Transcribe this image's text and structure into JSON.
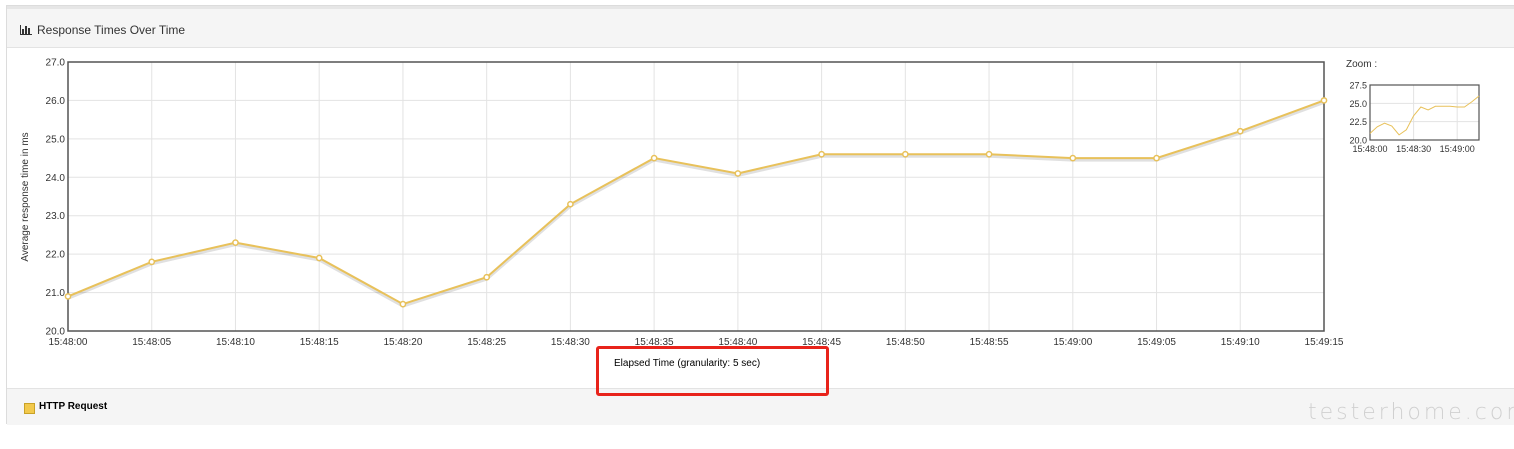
{
  "panel": {
    "title": "Response Times Over Time"
  },
  "legend": {
    "items": [
      {
        "label": "HTTP Request",
        "color": "#f2c94c"
      }
    ]
  },
  "zoom": {
    "label": "Zoom :",
    "y_ticks": [
      "27.5",
      "25.0",
      "22.5",
      "20.0"
    ],
    "x_ticks": [
      "15:48:00",
      "15:48:30",
      "15:49:00"
    ]
  },
  "watermark": "testerhome.com",
  "colors": {
    "series": "#e8c15a",
    "annotation": "#e8231b",
    "grid": "#e3e3e3"
  },
  "chart_data": {
    "type": "line",
    "title": "",
    "xlabel": "Elapsed Time (granularity: 5 sec)",
    "ylabel": "Average response time in ms",
    "categories": [
      "15:48:00",
      "15:48:05",
      "15:48:10",
      "15:48:15",
      "15:48:20",
      "15:48:25",
      "15:48:30",
      "15:48:35",
      "15:48:40",
      "15:48:45",
      "15:48:50",
      "15:48:55",
      "15:49:00",
      "15:49:05",
      "15:49:10",
      "15:49:15"
    ],
    "series": [
      {
        "name": "HTTP Request",
        "values": [
          20.9,
          21.8,
          22.3,
          21.9,
          20.7,
          21.4,
          23.3,
          24.5,
          24.1,
          24.6,
          24.6,
          24.6,
          24.5,
          24.5,
          25.2,
          26.0
        ]
      }
    ],
    "ylim": [
      20.0,
      27.0
    ],
    "y_ticks": [
      "20.0",
      "21.0",
      "22.0",
      "23.0",
      "24.0",
      "25.0",
      "26.0",
      "27.0"
    ],
    "grid": true,
    "legend_position": "bottom-left"
  }
}
